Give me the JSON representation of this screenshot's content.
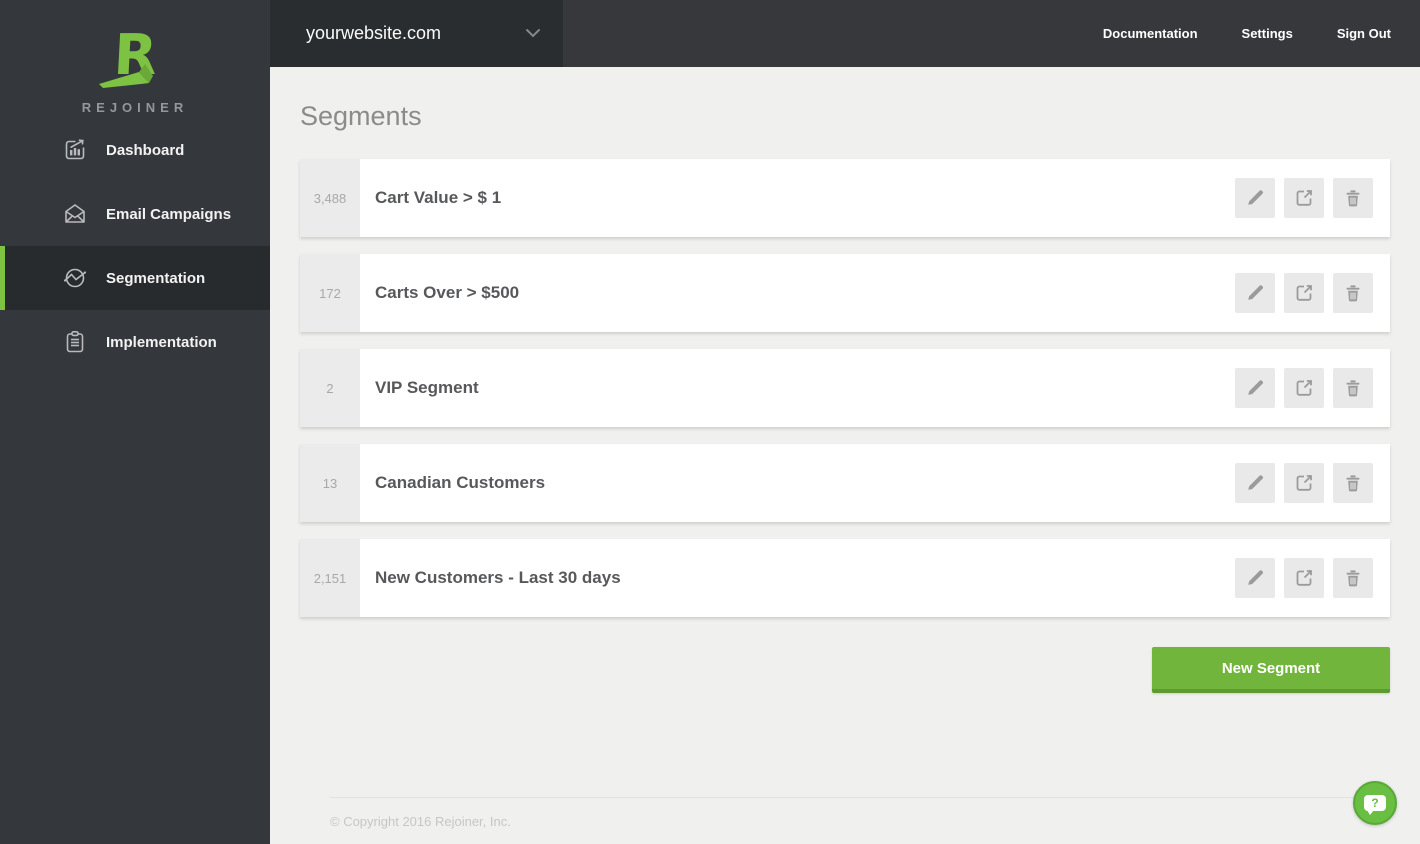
{
  "brand": {
    "logo_letter": "R",
    "name": "REJOINER"
  },
  "topbar": {
    "site_selector": {
      "value": "yourwebsite.com"
    },
    "links": [
      {
        "label": "Documentation"
      },
      {
        "label": "Settings"
      },
      {
        "label": "Sign Out"
      }
    ]
  },
  "sidebar": {
    "items": [
      {
        "label": "Dashboard",
        "icon": "dashboard-chart-icon",
        "active": false
      },
      {
        "label": "Email Campaigns",
        "icon": "envelope-icon",
        "active": false
      },
      {
        "label": "Segmentation",
        "icon": "segmentation-wave-icon",
        "active": true
      },
      {
        "label": "Implementation",
        "icon": "clipboard-icon",
        "active": false
      }
    ]
  },
  "main": {
    "title": "Segments",
    "segments": [
      {
        "count": "3,488",
        "name": "Cart Value > $ 1"
      },
      {
        "count": "172",
        "name": "Carts Over > $500"
      },
      {
        "count": "2",
        "name": "VIP Segment"
      },
      {
        "count": "13",
        "name": "Canadian Customers"
      },
      {
        "count": "2,151",
        "name": "New Customers - Last 30 days"
      }
    ],
    "row_actions": [
      {
        "name": "edit",
        "icon": "pencil-icon"
      },
      {
        "name": "export",
        "icon": "export-icon"
      },
      {
        "name": "delete",
        "icon": "trash-icon"
      }
    ],
    "new_segment_label": "New Segment"
  },
  "footer": {
    "copyright": "© Copyright 2016 Rejoiner, Inc."
  },
  "help_widget": {
    "glyph": "?"
  },
  "colors": {
    "accent_green": "#7dc243",
    "button_green": "#72b53c",
    "button_green_dark": "#5e9a2f",
    "help_green": "#69bf41",
    "sidebar_bg": "#34373c",
    "sidebar_active_bg": "#282b2e",
    "topbar_bg": "#36383c",
    "site_selector_bg": "#2a2d30",
    "content_bg": "#f0f0ee",
    "count_cell_bg": "#ebebeb"
  }
}
